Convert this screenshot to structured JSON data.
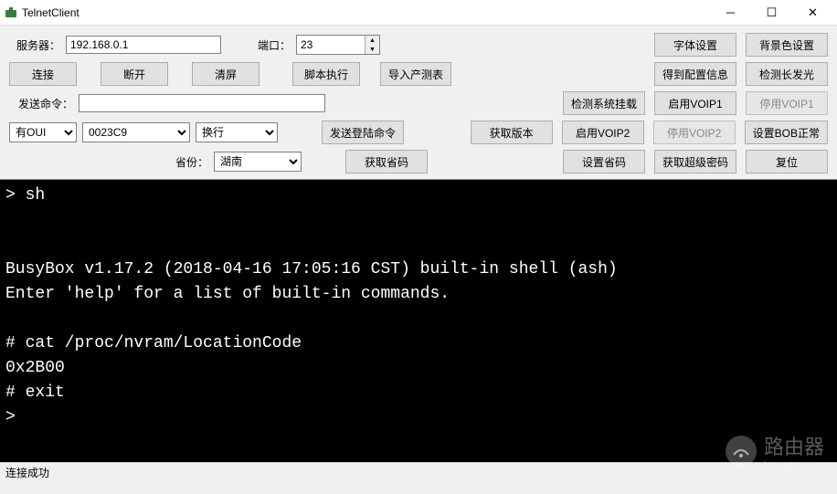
{
  "window": {
    "title": "TelnetClient"
  },
  "labels": {
    "server": "服务器：",
    "port": "端口：",
    "send_cmd": "发送命令：",
    "province": "省份："
  },
  "fields": {
    "server": "192.168.0.1",
    "port": "23",
    "send_cmd": "",
    "oui_mode": "有OUI",
    "oui_value": "0023C9",
    "wrap_mode": "换行",
    "province": "湖南"
  },
  "buttons": {
    "font_settings": "字体设置",
    "bg_settings": "背景色设置",
    "connect": "连接",
    "disconnect": "断开",
    "clear": "清屏",
    "run_script": "脚本执行",
    "import_table": "导入产测表",
    "get_config": "得到配置信息",
    "check_long_light": "检测长发光",
    "check_sysmount": "检测系统挂载",
    "enable_voip1": "启用VOIP1",
    "disable_voip1": "停用VOIP1",
    "send_login": "发送登陆命令",
    "get_version": "获取版本",
    "enable_voip2": "启用VOIP2",
    "disable_voip2": "停用VOIP2",
    "set_bob_normal": "设置BOB正常",
    "get_prov_code": "获取省码",
    "set_prov_code": "设置省码",
    "get_super_pwd": "获取超级密码",
    "reset": "复位"
  },
  "terminal_text": "> sh\n\n\nBusyBox v1.17.2 (2018-04-16 17:05:16 CST) built-in shell (ash)\nEnter 'help' for a list of built-in commands.\n\n# cat /proc/nvram/LocationCode\n0x2B00\n# exit\n>",
  "status": "连接成功",
  "watermark": {
    "text": "路由器",
    "sub": "luyouqi.com"
  }
}
